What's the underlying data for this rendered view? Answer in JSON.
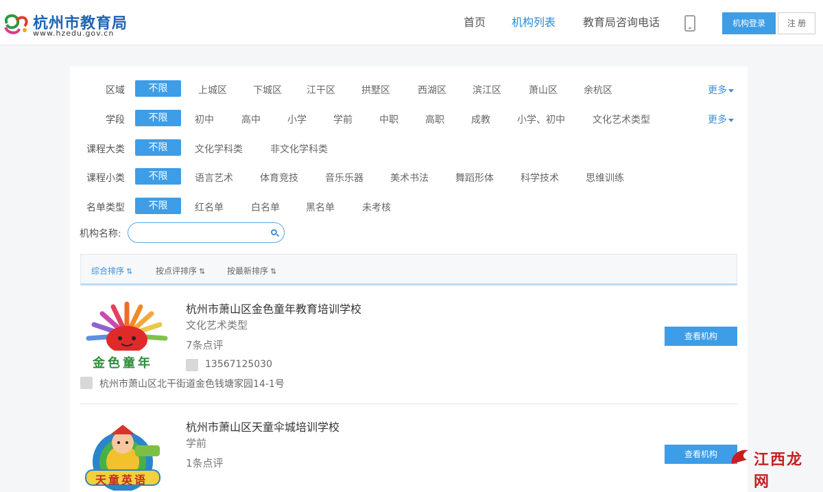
{
  "header": {
    "logo_title": "杭州市教育局",
    "logo_url": "www.hzedu.gov.cn",
    "nav": [
      "首页",
      "机构列表",
      "教育局咨询电话"
    ],
    "login_label": "机构登录",
    "register_label": "注 册"
  },
  "filters": {
    "region": {
      "label": "区域",
      "active": "不限",
      "options": [
        "上城区",
        "下城区",
        "江干区",
        "拱墅区",
        "西湖区",
        "滨江区",
        "萧山区",
        "余杭区"
      ],
      "more": "更多"
    },
    "stage": {
      "label": "学段",
      "active": "不限",
      "options": [
        "初中",
        "高中",
        "小学",
        "学前",
        "中职",
        "高职",
        "成教",
        "小学、初中",
        "文化艺术类型"
      ],
      "more": "更多"
    },
    "course_major": {
      "label": "课程大类",
      "active": "不限",
      "options": [
        "文化学科类",
        "非文化学科类"
      ]
    },
    "course_minor": {
      "label": "课程小类",
      "active": "不限",
      "options": [
        "语言艺术",
        "体育竞技",
        "音乐乐器",
        "美术书法",
        "舞蹈形体",
        "科学技术",
        "思维训练"
      ]
    },
    "list_type": {
      "label": "名单类型",
      "active": "不限",
      "options": [
        "红名单",
        "白名单",
        "黑名单",
        "未考核"
      ]
    }
  },
  "search": {
    "label": "机构名称:",
    "value": "",
    "placeholder": ""
  },
  "sort": [
    "综合排序",
    "按点评排序",
    "按最新排序"
  ],
  "sort_arrows": "⇅",
  "orgs": [
    {
      "name": "杭州市萧山区金色童年教育培训学校",
      "type": "文化艺术类型",
      "reviews": "7条点评",
      "phone": "13567125030",
      "address": "杭州市萧山区北干街道金色钱塘家园14-1号",
      "logo_text": "金色童年",
      "button": "查看机构"
    },
    {
      "name": "杭州市萧山区天童伞城培训学校",
      "type": "学前",
      "reviews": "1条点评",
      "logo_text": "天童英语",
      "button": "查看机构"
    }
  ],
  "watermark": "江西龙网",
  "colors": {
    "accent": "#3d9de6",
    "link": "#3d8ed6",
    "logo_blue": "#1d63b3"
  }
}
